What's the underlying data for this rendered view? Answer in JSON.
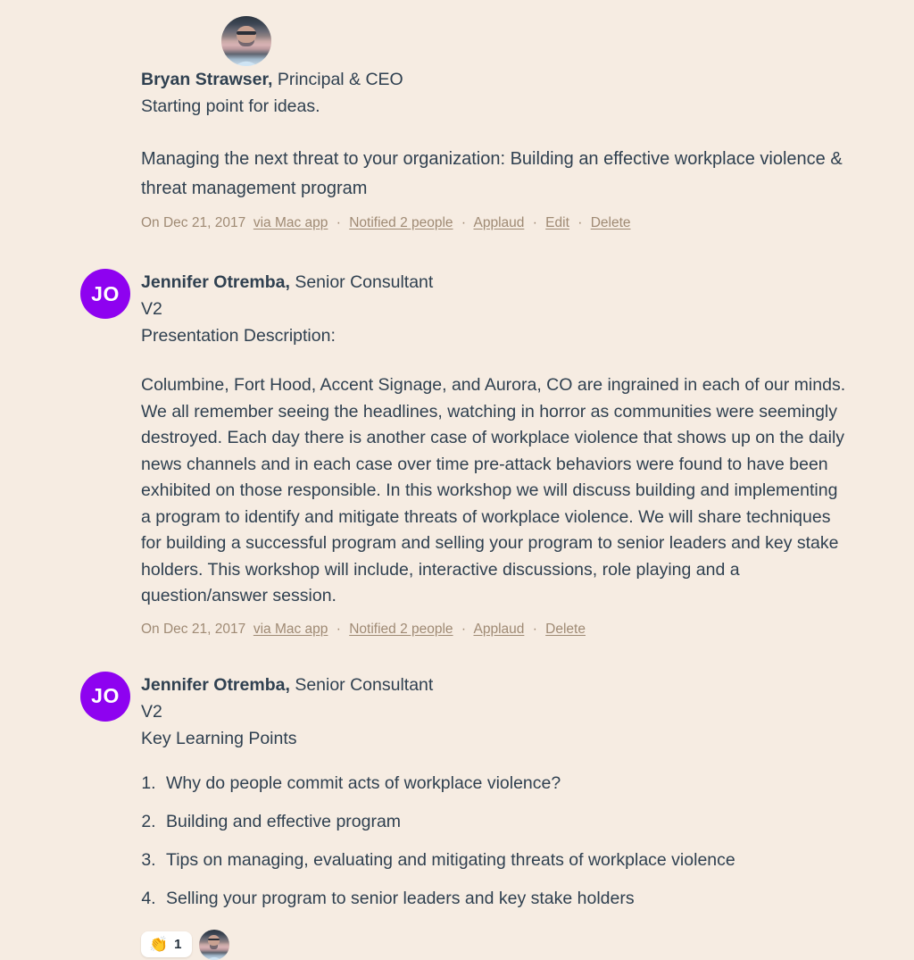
{
  "theme": {
    "background": "#f6ece2",
    "text_color": "#2f4050",
    "meta_color": "#9f8a74",
    "avatar_accent": "#8e02f0"
  },
  "posts": [
    {
      "author_name": "Bryan Strawser,",
      "author_role": "Principal & CEO",
      "avatar_type": "photo",
      "subline": "Starting point for ideas.",
      "title": "Managing the next threat to your organization: Building an effective workplace violence & threat management program",
      "meta": {
        "date_prefix": "On Dec 21, 2017",
        "via": "via Mac app",
        "notified": "Notified 2 people",
        "applaud": "Applaud",
        "edit": "Edit",
        "delete": "Delete",
        "separator": "·"
      }
    },
    {
      "author_name": "Jennifer Otremba,",
      "author_role": "Senior Consultant",
      "avatar_type": "initials",
      "avatar_initials": "JO",
      "version": "V2",
      "subline": "Presentation Description:",
      "body": "Columbine, Fort Hood, Accent Signage, and Aurora, CO are ingrained in each of our minds.  We all remember seeing the headlines, watching in horror as communities were seemingly destroyed.  Each day there is another case of workplace violence that shows up on the daily news channels and in each case over time pre-attack behaviors were found to have been exhibited on those responsible.  In this workshop we will discuss building and implementing a program to identify and mitigate threats of workplace violence.    We will share techniques for building a successful program and selling your program to senior leaders and key stake holders.  This workshop will include, interactive discussions, role playing and a question/answer session.",
      "meta": {
        "date_prefix": "On Dec 21, 2017",
        "via": "via Mac app",
        "notified": "Notified 2 people",
        "applaud": "Applaud",
        "delete": "Delete",
        "separator": "·"
      }
    },
    {
      "author_name": "Jennifer Otremba,",
      "author_role": "Senior Consultant",
      "avatar_type": "initials",
      "avatar_initials": "JO",
      "version": "V2",
      "subline": "Key Learning Points",
      "points": [
        "Why do people commit acts of workplace violence?",
        "Building and effective program",
        "Tips on managing, evaluating and mitigating threats of workplace violence",
        "Selling your program to senior leaders and key stake holders"
      ],
      "reaction": {
        "emoji": "clap-emoji",
        "emoji_glyph": "👏",
        "count": "1"
      }
    }
  ]
}
